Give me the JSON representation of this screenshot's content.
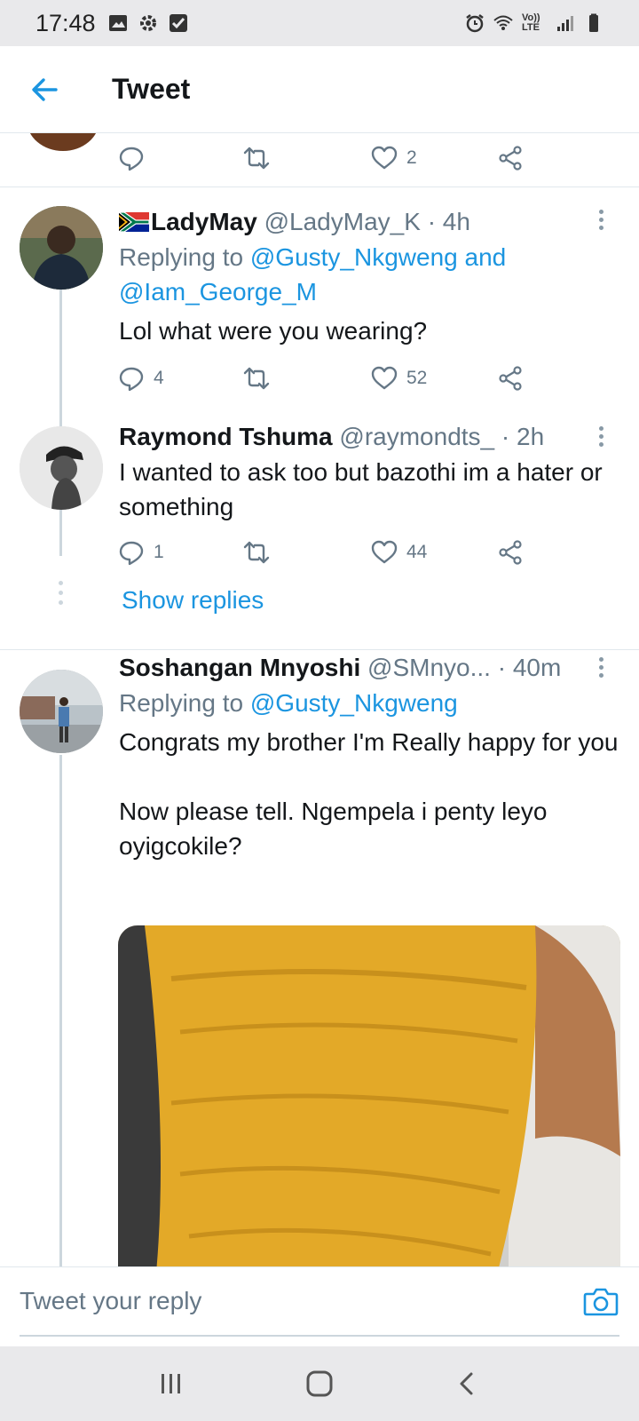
{
  "status_bar": {
    "time": "17:48",
    "network_label": "Vo)) LTE"
  },
  "header": {
    "title": "Tweet"
  },
  "top_actions": {
    "like_count": "2"
  },
  "tweets": [
    {
      "name": "LadyMay",
      "handle": "@LadyMay_K",
      "time": "· 4h",
      "replying_prefix": "Replying to ",
      "replying_links": [
        "@Gusty_Nkgweng",
        "@Iam_George_M"
      ],
      "replying_joiner": " and ",
      "text": "Lol what were you wearing?",
      "reply_count": "4",
      "retweet_count": "",
      "like_count": "52"
    },
    {
      "name": "Raymond Tshuma",
      "handle": "@raymondts_",
      "time": "· 2h",
      "text": "I wanted to ask too but bazothi im a hater or something",
      "reply_count": "1",
      "retweet_count": "",
      "like_count": "44"
    },
    {
      "name": "Soshangan Mnyoshi",
      "handle": "@SMnyo...",
      "time": "· 40m",
      "replying_prefix": "Replying to ",
      "replying_links": [
        "@Gusty_Nkgweng"
      ],
      "text": "Congrats my brother I'm Really happy for you\n\nNow please tell. Ngempela i penty leyo oyigcokile?"
    }
  ],
  "show_replies_label": "Show replies",
  "reply_bar": {
    "placeholder": "Tweet your reply"
  },
  "colors": {
    "accent": "#1b95e0",
    "muted": "#657786",
    "divider": "#e1e8ed"
  },
  "icons": [
    "back-arrow-icon",
    "reply-icon",
    "retweet-icon",
    "heart-icon",
    "share-icon",
    "more-vertical-icon",
    "camera-icon",
    "recents-icon",
    "home-icon",
    "back-nav-icon"
  ]
}
